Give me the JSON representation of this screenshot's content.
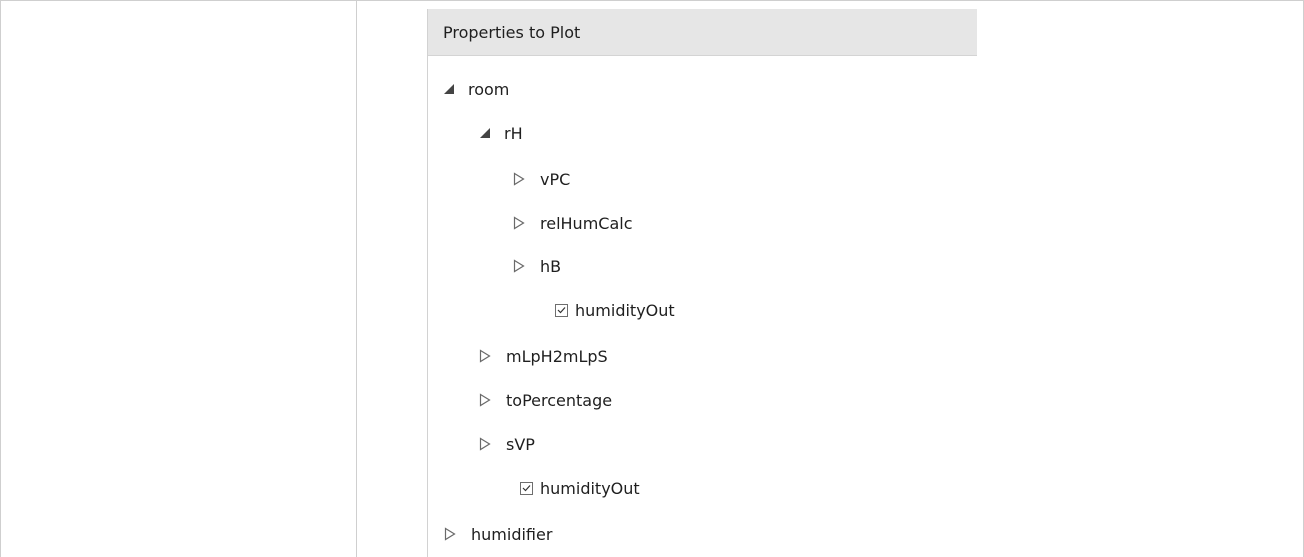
{
  "panel": {
    "title": "Properties to Plot"
  },
  "tree": [
    {
      "label": "room",
      "kind": "expanded",
      "name": "tree-node-room"
    },
    {
      "label": "rH",
      "kind": "expanded",
      "name": "tree-node-rh"
    },
    {
      "label": "vPC",
      "kind": "collapsed",
      "name": "tree-node-vpc"
    },
    {
      "label": "relHumCalc",
      "kind": "collapsed",
      "name": "tree-node-relhumcalc"
    },
    {
      "label": "hB",
      "kind": "collapsed",
      "name": "tree-node-hb"
    },
    {
      "label": "humidityOut",
      "kind": "checkbox",
      "checked": true,
      "name": "tree-node-humidityout-rh"
    },
    {
      "label": "mLpH2mLpS",
      "kind": "collapsed",
      "name": "tree-node-mlph2mlps"
    },
    {
      "label": "toPercentage",
      "kind": "collapsed",
      "name": "tree-node-topercentage"
    },
    {
      "label": "sVP",
      "kind": "collapsed",
      "name": "tree-node-svp"
    },
    {
      "label": "humidityOut",
      "kind": "checkbox",
      "checked": true,
      "name": "tree-node-humidityout-room"
    },
    {
      "label": "humidifier",
      "kind": "collapsed",
      "name": "tree-node-humidifier"
    }
  ]
}
